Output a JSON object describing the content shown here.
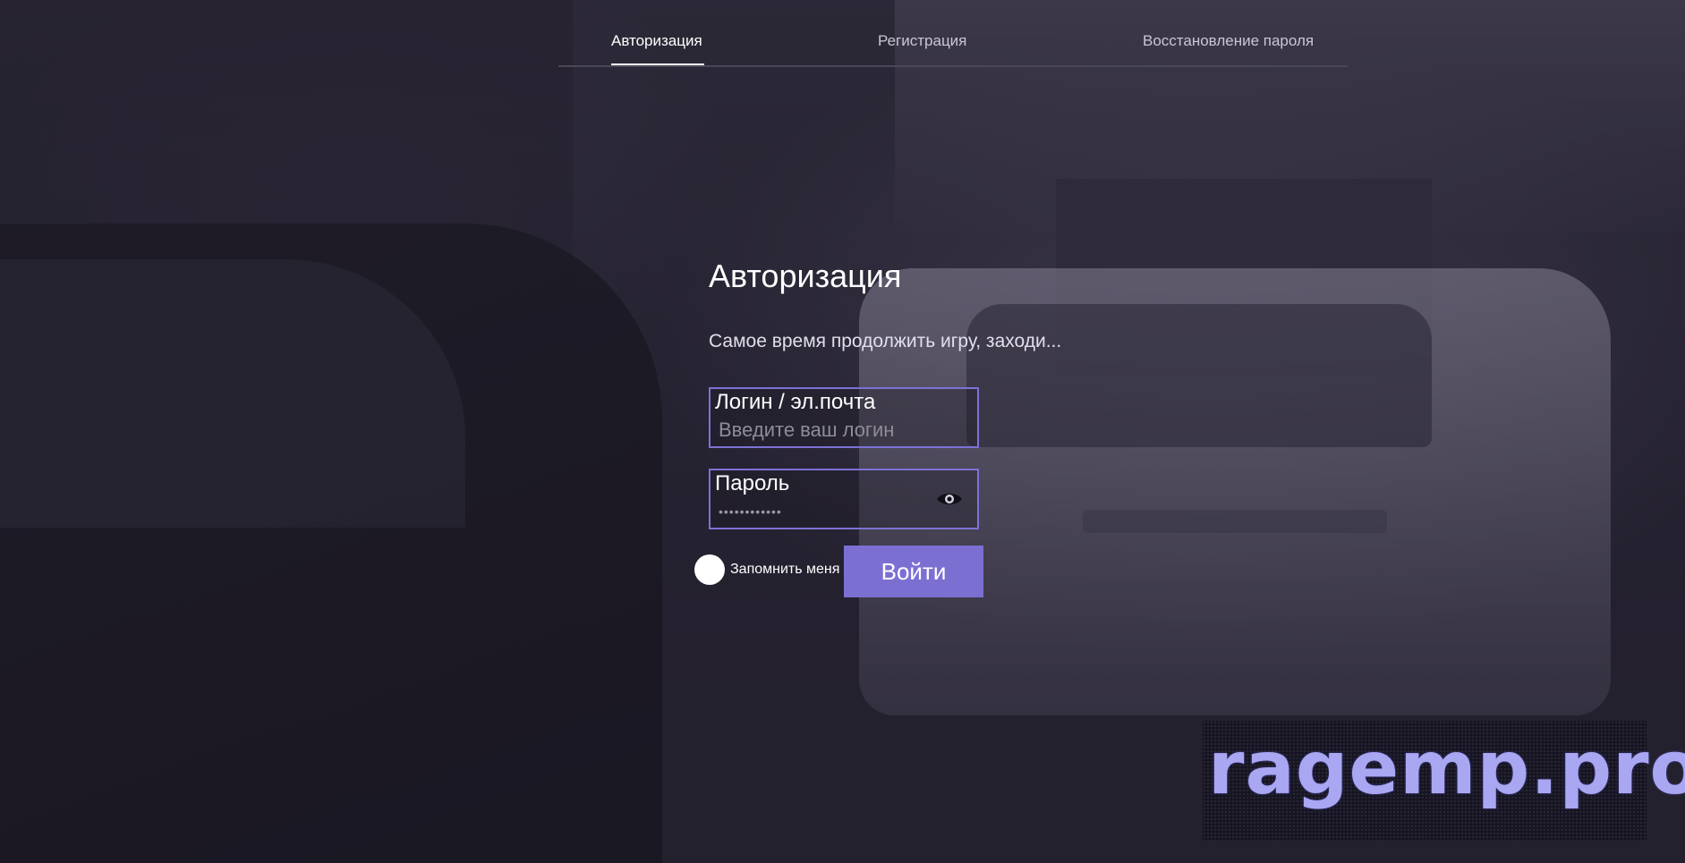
{
  "nav": {
    "tabs": [
      {
        "label": "Авторизация",
        "active": true
      },
      {
        "label": "Регистрация",
        "active": false
      },
      {
        "label": "Восстановление пароля",
        "active": false
      }
    ]
  },
  "form": {
    "title": "Авторизация",
    "subtitle": "Самое время продолжить игру, заходи...",
    "login": {
      "label": "Логин / эл.почта",
      "placeholder": "Введите ваш логин",
      "value": ""
    },
    "password": {
      "label": "Пароль",
      "placeholder": "••••••••••••",
      "value": "",
      "toggle_icon": "eye-icon"
    },
    "remember": {
      "label": "Запомнить меня",
      "checked": false
    },
    "submit_label": "Войти"
  },
  "watermark": {
    "text": "ragemp.pro"
  },
  "colors": {
    "accent": "#7b70d2",
    "field_border": "#7d72d6",
    "background": "#23212e",
    "text": "#ffffff"
  }
}
